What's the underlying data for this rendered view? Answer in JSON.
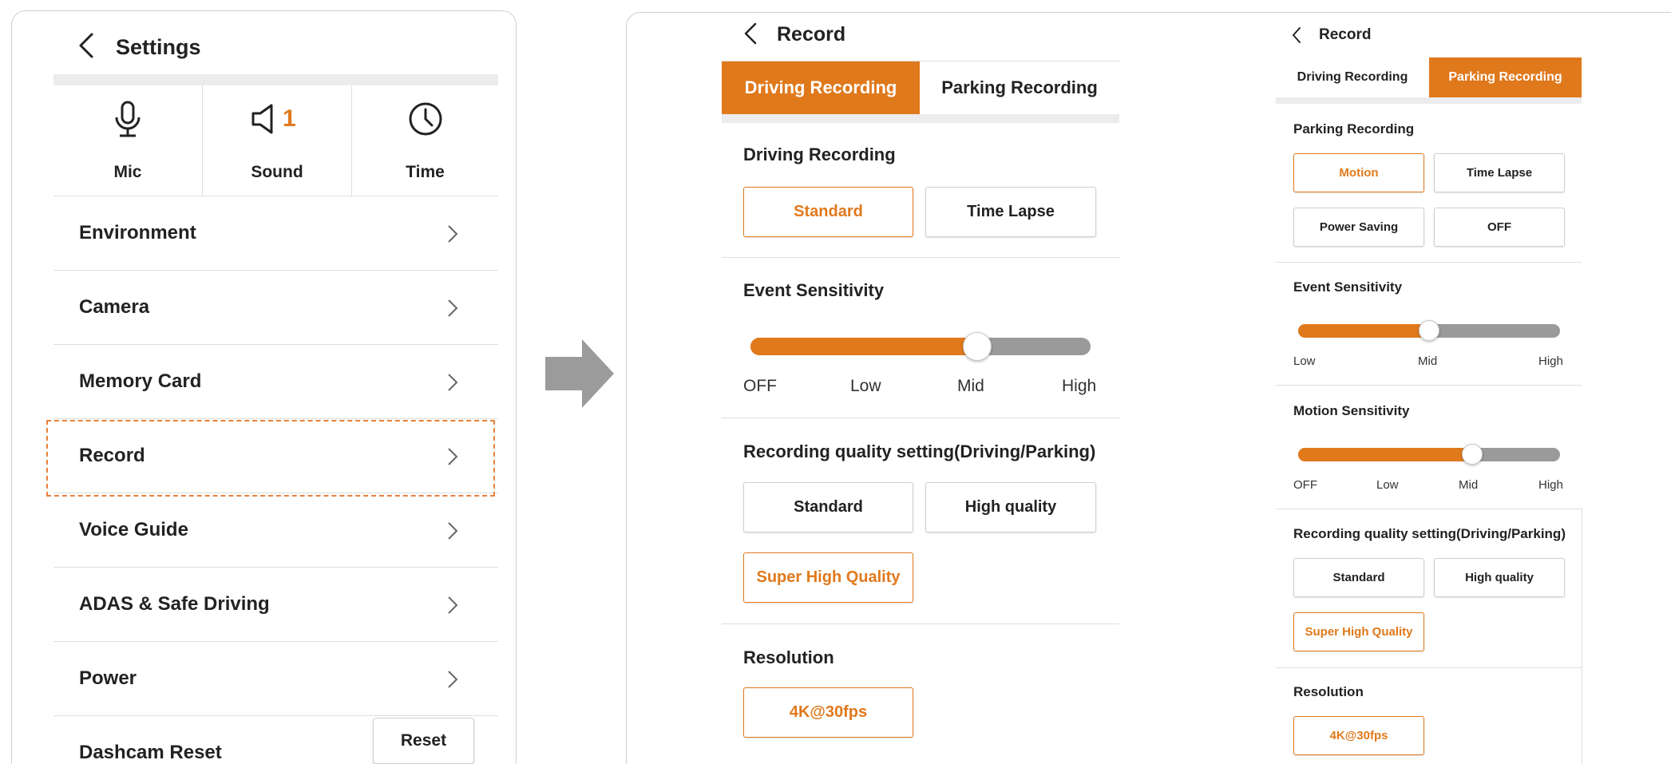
{
  "settings": {
    "title": "Settings",
    "quick": [
      {
        "label": "Mic",
        "icon": "mic-icon"
      },
      {
        "label": "Sound",
        "icon": "speaker-icon",
        "badge": "1"
      },
      {
        "label": "Time",
        "icon": "clock-icon"
      }
    ],
    "menu": [
      "Environment",
      "Camera",
      "Memory Card",
      "Record",
      "Voice Guide",
      "ADAS & Safe Driving",
      "Power"
    ],
    "reset_row": {
      "label": "Dashcam Reset",
      "button": "Reset"
    },
    "highlighted_item": "Record"
  },
  "arrow_icon": "right-arrow-icon",
  "record_driving": {
    "title": "Record",
    "tabs": [
      "Driving Recording",
      "Parking Recording"
    ],
    "active_tab": "Driving Recording",
    "recording": {
      "title": "Driving Recording",
      "options": [
        "Standard",
        "Time Lapse"
      ],
      "selected": "Standard"
    },
    "event_sensitivity": {
      "title": "Event Sensitivity",
      "ticks": [
        "OFF",
        "Low",
        "Mid",
        "High"
      ],
      "value": "Mid"
    },
    "quality": {
      "title": "Recording quality setting(Driving/Parking)",
      "options": [
        "Standard",
        "High quality",
        "Super High Quality"
      ],
      "selected": "Super High Quality"
    },
    "resolution": {
      "title": "Resolution",
      "value": "4K@30fps"
    }
  },
  "record_parking": {
    "title": "Record",
    "tabs": [
      "Driving Recording",
      "Parking Recording"
    ],
    "active_tab": "Parking Recording",
    "recording": {
      "title": "Parking Recording",
      "options": [
        "Motion",
        "Time Lapse",
        "Power Saving",
        "OFF"
      ],
      "selected": "Motion"
    },
    "event_sensitivity": {
      "title": "Event Sensitivity",
      "ticks": [
        "Low",
        "Mid",
        "High"
      ],
      "value": "Mid"
    },
    "motion_sensitivity": {
      "title": "Motion Sensitivity",
      "ticks": [
        "OFF",
        "Low",
        "Mid",
        "High"
      ],
      "value": "Mid"
    },
    "quality": {
      "title": "Recording quality setting(Driving/Parking)",
      "options": [
        "Standard",
        "High quality",
        "Super High Quality"
      ],
      "selected": "Super High Quality"
    },
    "resolution": {
      "title": "Resolution",
      "value": "4K@30fps"
    }
  },
  "colors": {
    "accent": "#e0791c",
    "track": "#9a9a9a",
    "highlight_dash": "#e8803a"
  }
}
